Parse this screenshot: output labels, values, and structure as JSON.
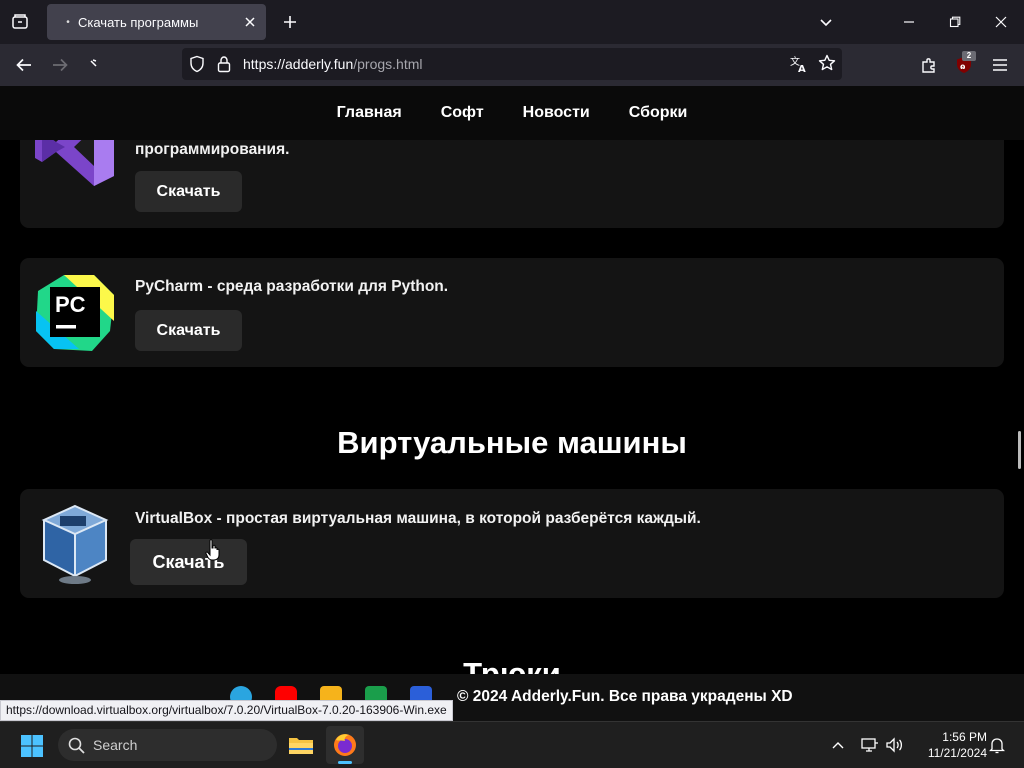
{
  "browser": {
    "tab_title": "Скачать программы",
    "url_host": "https://adderly.fun",
    "url_path": "/progs.html",
    "extension_badge": "2"
  },
  "site_nav": {
    "items": [
      "Главная",
      "Софт",
      "Новости",
      "Сборки"
    ]
  },
  "cards": {
    "visual_studio": {
      "desc": "программирования.",
      "button": "Скачать"
    },
    "pycharm": {
      "desc": "PyCharm - среда разработки для Python.",
      "button": "Скачать",
      "logo_text": "PC"
    },
    "virtualbox": {
      "desc": "VirtualBox - простая виртуальная машина, в которой разберётся каждый.",
      "button": "Скачать"
    }
  },
  "sections": {
    "virtual_machines": "Виртуальные машины",
    "tricks": "Трюки"
  },
  "footer": {
    "copyright": "© 2024 Adderly.Fun. Все права украдены XD"
  },
  "status_bar": {
    "link": "https://download.virtualbox.org/virtualbox/7.0.20/VirtualBox-7.0.20-163906-Win.exe"
  },
  "taskbar": {
    "search_label": "Search",
    "time": "1:56 PM",
    "date": "11/21/2024"
  },
  "colors": {
    "accent": "#4cc2ff",
    "page_bg": "#000000",
    "card_bg": "#141414",
    "button_bg": "#2a2a2a"
  }
}
